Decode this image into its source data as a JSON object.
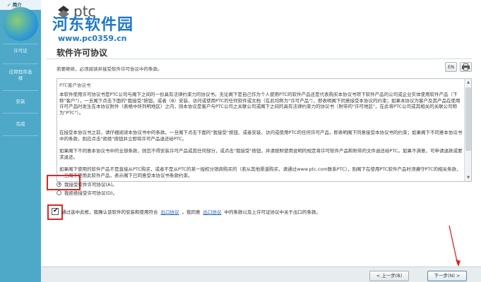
{
  "sidebar": {
    "items": [
      {
        "label": "简介",
        "active": true
      },
      {
        "label": "许可证"
      },
      {
        "label": "应用程序选择"
      },
      {
        "label": "安装"
      },
      {
        "label": "完成"
      }
    ]
  },
  "header": {
    "logo_text": "ptc",
    "watermark_title": "河东软件园",
    "watermark_url": "www.pc0359.cn"
  },
  "page": {
    "title": "软件许可协议",
    "instruction": "若要继续，必须阅读并接受软件许可协议中的条款。",
    "lang_button": "EN"
  },
  "license": {
    "heading": "PTC客户协议书",
    "paragraphs": [
      "本软件使用许可协议书是PTC公司与阁下之间的一份具有法律约束力的协议书。无论阁下是自己作为个人使用PTC的软件产品还是代表购买本协议书项下软件产品的公司或企业实体使用软件产品（下称\"客户\"），一旦阁下点击下面的\"我接受\"按钮，或者（B）安装、访问或使用PTC的任何软件或文档（在此均称为\"许可产品\"），即表明阁下同意接受本协议的约束；如果本协议为客户及其产品在使用许可产品时发生在本协议附件（表格中所列明地区）之内，则本协议是客户与PTC公司之关联公司或阁下之间的具有法律约束力的协议书（附带的\"许可地区\"，在此将PTC公司或其相关的关联公司称为\"PTC\"）。",
      "在接受本协议书之前，请仔细阅读本协议书中的条款。一旦阁下点击下面的\"我接受\"按钮、或者安装、访问或使用PTC的任何许可产品，即表明阁下同意接受本协议书的约束；如果阁下不同意本协议书中的条款，则应点击\"拒绝\"按钮并立即将许可产品退还给PTC。",
      "如果阁下不同意本协议书中的全部条款，则您不得安装许可产品或其任何部分，或点击\"我接受\"按钮，并请按照使用说明的规定将许可软件产品和附带的文件退还给PTC。如果不满意，可申请退款或要求退还。",
      "如果阁下使用的软件产品不是直接从PTC购买，或者不是从PTC的某一授权分销商购买的（若从其他渠道购买，请通过www.ptc.com联系PTC），则阁下在使用PTC软件产品时须遵守PTC的相关条款，一旦阁下使用此软件产品，表示阁下已同意受本协议书条款约束。"
    ]
  },
  "options": {
    "accept_label": "我接受软件许可协议(A)。",
    "decline_label": "我拒绝接受许可协议(D)。",
    "accept_selected": true
  },
  "export_check": {
    "text_1": "通过选中此框，我确认该软件的安装和使用符合",
    "link_1": "出口协议",
    "text_2": "。我同意",
    "link_2": "出口协议",
    "text_3": "中的条款以及上许可证协议中关于出口的条款。",
    "checked": true
  },
  "footer": {
    "back_label": "< 上一步(B)",
    "next_label": "下一步(N) >"
  },
  "colors": {
    "sidebar": "#4ea9c9",
    "highlight": "#e02424",
    "watermark": "#1e78c8"
  }
}
